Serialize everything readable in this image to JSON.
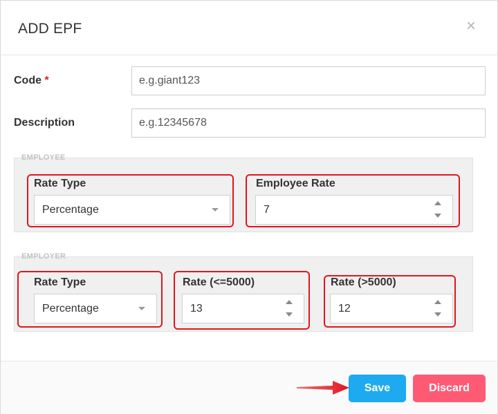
{
  "modal": {
    "title": "ADD EPF",
    "close_glyph": "×",
    "close_icon": "close-icon"
  },
  "form": {
    "code": {
      "label": "Code",
      "required_mark": "*",
      "placeholder": "e.g.giant123",
      "value": ""
    },
    "description": {
      "label": "Description",
      "placeholder": "e.g.12345678",
      "value": ""
    }
  },
  "employee": {
    "section_title": "EMPLOYEE",
    "rate_type": {
      "label": "Rate Type",
      "value": "Percentage"
    },
    "employee_rate": {
      "label": "Employee Rate",
      "value": "7"
    }
  },
  "employer": {
    "section_title": "EMPLOYER",
    "rate_type": {
      "label": "Rate Type",
      "value": "Percentage"
    },
    "rate_le_5000": {
      "label": "Rate (<=5000)",
      "value": "13"
    },
    "rate_gt_5000": {
      "label": "Rate (>5000)",
      "value": "12"
    }
  },
  "footer": {
    "save_label": "Save",
    "discard_label": "Discard"
  },
  "colors": {
    "save": "#1eaaf0",
    "discard": "#ff5a74",
    "highlight": "#e3141e",
    "required": "#e02020"
  }
}
